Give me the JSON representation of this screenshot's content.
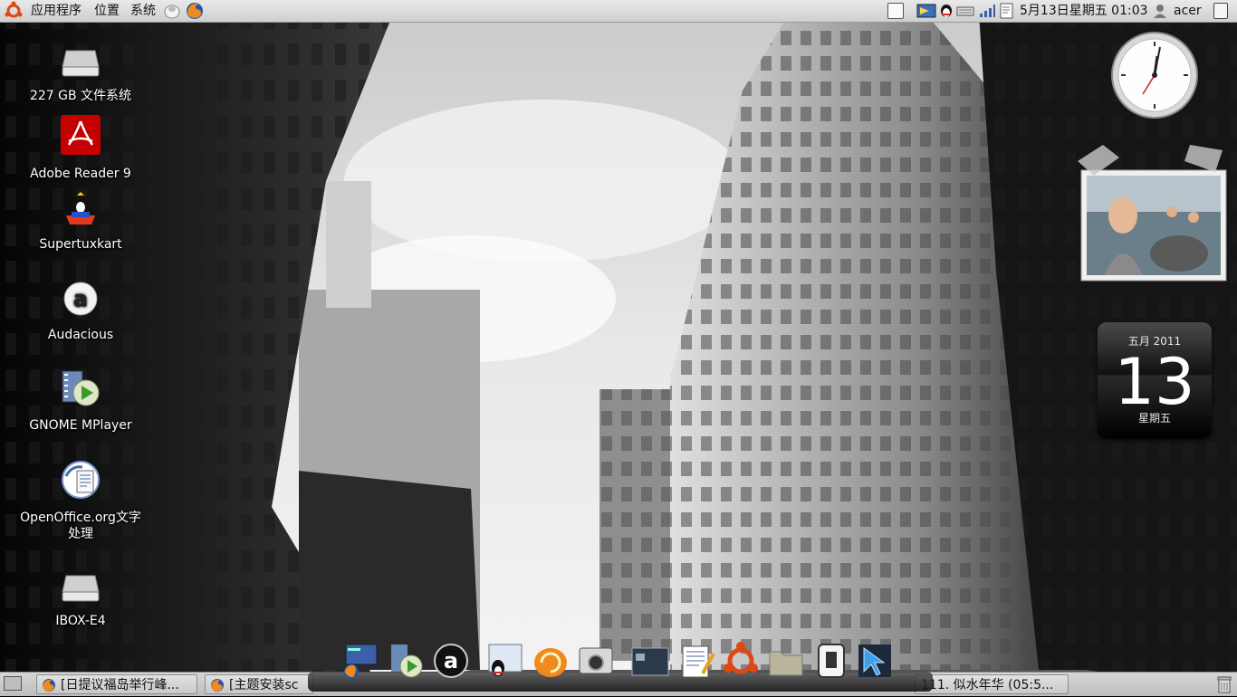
{
  "top_panel": {
    "menus": [
      "应用程序",
      "位置",
      "系统"
    ],
    "datetime": "5月13日星期五 01:03",
    "user": "acer"
  },
  "desktop_icons": [
    {
      "label": "227 GB 文件系统",
      "icon": "drive-icon"
    },
    {
      "label": "Adobe Reader 9",
      "icon": "adobe-reader-icon"
    },
    {
      "label": "Supertuxkart",
      "icon": "supertuxkart-icon"
    },
    {
      "label": "Audacious",
      "icon": "audacious-icon"
    },
    {
      "label": "GNOME MPlayer",
      "icon": "mplayer-icon"
    },
    {
      "label": "OpenOffice.org文字处理",
      "icon": "openoffice-writer-icon"
    },
    {
      "label": "IBOX-E4",
      "icon": "drive-icon"
    }
  ],
  "taskbar": {
    "tasks": [
      {
        "label": "[日提议福岛举行峰..."
      },
      {
        "label": "[主题安装sc"
      },
      {
        "label": "111. 似水年华 (05:5..."
      }
    ]
  },
  "widgets": {
    "calendar": {
      "month": "五月 2011",
      "day": "13",
      "weekday": "星期五"
    }
  },
  "colors": {
    "panel_bg": "#d4d4d4",
    "ubuntu_orange": "#dd4814",
    "adobe_red": "#c40000"
  }
}
